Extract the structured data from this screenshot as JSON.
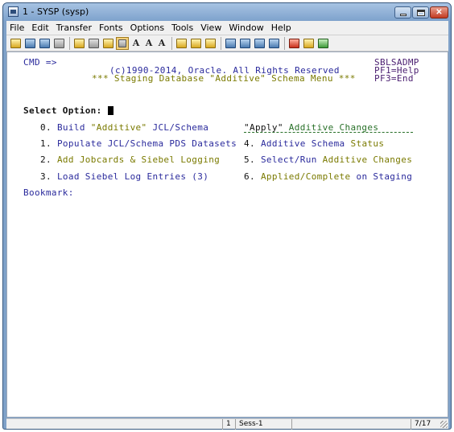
{
  "window": {
    "title": "1 - SYSP (sysp)"
  },
  "menu": [
    "File",
    "Edit",
    "Transfer",
    "Fonts",
    "Options",
    "Tools",
    "View",
    "Window",
    "Help"
  ],
  "terminal": {
    "cmd_prompt": "CMD =>",
    "copyright": "(c)1990-2014, Oracle. All Rights Reserved",
    "menu_title": "*** Staging Database \"Additive\" Schema Menu ***",
    "panel_id": "SBLSADMP",
    "pf1": "PF1=Help",
    "pf3": "PF3=End",
    "select_option_label": "Select Option:",
    "options_left": [
      {
        "num": "0.",
        "prefix": "Build ",
        "highlight": "\"Additive\"",
        "suffix": " JCL/Schema"
      },
      {
        "num": "1.",
        "text": "Populate JCL/Schema PDS Datasets"
      },
      {
        "num": "2.",
        "text": "Add Jobcards & Siebel Logging"
      },
      {
        "num": "3.",
        "text": "Load Siebel Log Entries (3)"
      }
    ],
    "apply_header": {
      "quote": "\"Apply\"",
      "rest": " Additive Changes"
    },
    "options_right": [
      {
        "num": "4.",
        "prefix": "Additive Schema ",
        "highlight": "Status"
      },
      {
        "num": "5.",
        "prefix": "Select/Run ",
        "highlight": "Additive Changes"
      },
      {
        "num": "6.",
        "prefix": "Applied/Complete",
        "highlight": " on Staging"
      }
    ],
    "bookmark_label": "Bookmark:"
  },
  "statusbar": {
    "session_num": "1",
    "session_name": "Sess-1",
    "page": "7/17"
  },
  "colors": {
    "titlebar": "#7ea2cc",
    "text_blue": "#2a2a9c",
    "text_green": "#287028",
    "text_olive": "#7a7a00"
  }
}
